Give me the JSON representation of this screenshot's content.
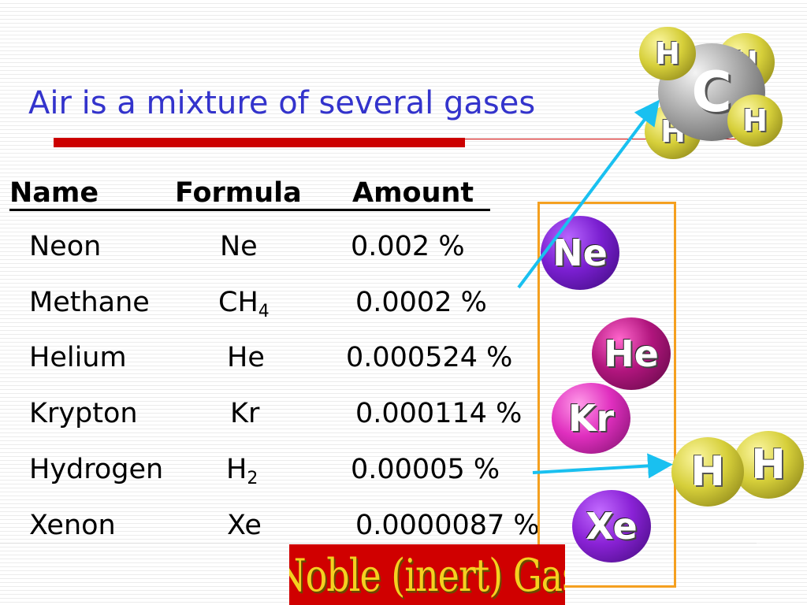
{
  "title": "Air is a mixture of several gases",
  "table": {
    "headers": {
      "name": "Name",
      "formula": "Formula",
      "amount": "Amount"
    },
    "rows": [
      {
        "name": "Neon",
        "formula": "Ne",
        "formula_sub": "",
        "amount": "0.002 %"
      },
      {
        "name": "Methane",
        "formula": "CH",
        "formula_sub": "4",
        "amount": "0.0002 %"
      },
      {
        "name": "Helium",
        "formula": "He",
        "formula_sub": "",
        "amount": "0.000524 %"
      },
      {
        "name": "Krypton",
        "formula": "Kr",
        "formula_sub": "",
        "amount": "0.000114 %"
      },
      {
        "name": "Hydrogen",
        "formula": "H",
        "formula_sub": "2",
        "amount": "0.00005 %"
      },
      {
        "name": "Xenon",
        "formula": "Xe",
        "formula_sub": "",
        "amount": "0.0000087 %"
      }
    ]
  },
  "atoms": {
    "ne": "Ne",
    "he": "He",
    "kr": "Kr",
    "xe": "Xe",
    "h": "H",
    "c": "C"
  },
  "noble_label": "Noble (inert) Gas",
  "colors": {
    "title": "#3333cc",
    "accent_bar": "#cc0000",
    "box_border": "#f5a020",
    "arrow": "#19c0f0",
    "noble_bg": "#d00000",
    "noble_text": "#f5d020"
  }
}
